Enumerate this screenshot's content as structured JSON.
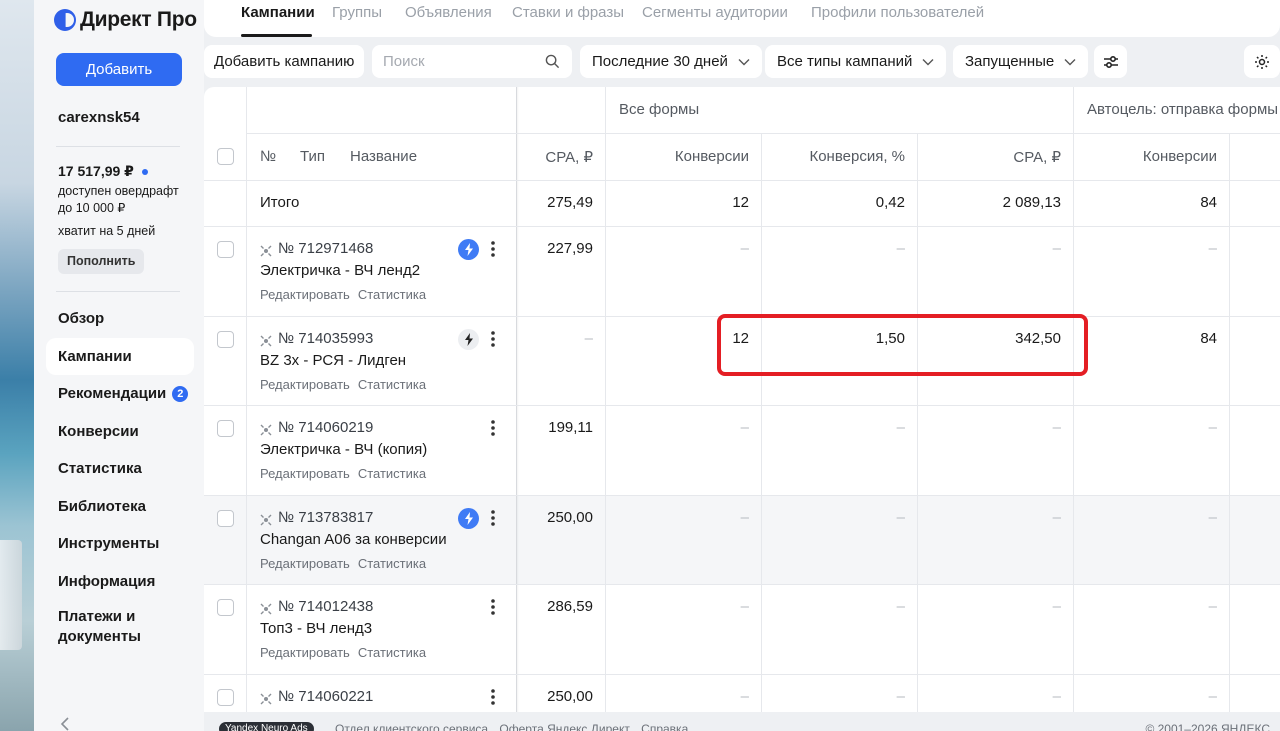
{
  "sidebar": {
    "logo": "Директ Про",
    "add_button": "Добавить",
    "login": "carexnsk54",
    "balance": "17 517,99 ₽",
    "overdraft": "доступен овердрафт до 10 000 ₽",
    "enough": "хватит на 5 дней",
    "topup": "Пополнить",
    "nav": [
      {
        "label": "Обзор"
      },
      {
        "label": "Кампании"
      },
      {
        "label": "Рекомендации",
        "badge": "2"
      },
      {
        "label": "Конверсии"
      },
      {
        "label": "Статистика"
      },
      {
        "label": "Библиотека"
      },
      {
        "label": "Инструменты"
      },
      {
        "label": "Информация"
      },
      {
        "label": "Платежи и документы"
      }
    ]
  },
  "tabs": [
    "Кампании",
    "Группы",
    "Объявления",
    "Ставки и фразы",
    "Сегменты аудитории",
    "Профили пользователей"
  ],
  "toolbar": {
    "add_campaign": "Добавить кампанию",
    "search_placeholder": "Поиск",
    "period": "Последние 30 дней",
    "types": "Все типы кампаний",
    "status": "Запущенные"
  },
  "table": {
    "group_headers": {
      "all_forms": "Все формы",
      "autogoal": "Автоцель: отправка формы"
    },
    "headers": {
      "num": "№",
      "type": "Тип",
      "name": "Название",
      "cpa": "CPA, ₽",
      "conv": "Конверсии",
      "conv_pct": "Конверсия, %",
      "cpa2": "CPA, ₽",
      "conv2": "Конверсии"
    },
    "total": {
      "label": "Итого",
      "cpa": "275,49",
      "conv": "12",
      "conv_pct": "0,42",
      "cpa2": "2 089,13",
      "conv2": "84"
    },
    "edit_label": "Редактировать",
    "stats_label": "Статистика",
    "rows": [
      {
        "num": "№ 712971468",
        "name": "Электричка - ВЧ ленд2",
        "cpa": "227,99",
        "conv": "–",
        "conv_pct": "–",
        "cpa2": "–",
        "conv2": "–"
      },
      {
        "num": "№ 714035993",
        "name": "BZ 3x - РСЯ - Лидген",
        "cpa": "–",
        "conv": "12",
        "conv_pct": "1,50",
        "cpa2": "342,50",
        "conv2": "84"
      },
      {
        "num": "№ 714060219",
        "name": "Электричка - ВЧ (копия)",
        "cpa": "199,11",
        "conv": "–",
        "conv_pct": "–",
        "cpa2": "–",
        "conv2": "–"
      },
      {
        "num": "№ 713783817",
        "name": "Changan A06 за конверсии",
        "cpa": "250,00",
        "conv": "–",
        "conv_pct": "–",
        "cpa2": "–",
        "conv2": "–"
      },
      {
        "num": "№ 714012438",
        "name": "Топ3 - ВЧ ленд3",
        "cpa": "286,59",
        "conv": "–",
        "conv_pct": "–",
        "cpa2": "–",
        "conv2": "–"
      },
      {
        "num": "№ 714060221",
        "name": "",
        "cpa": "250,00",
        "conv": "–",
        "conv_pct": "–",
        "cpa2": "–",
        "conv2": "–"
      }
    ]
  },
  "footer": {
    "logo": "Yandex Neuro Ads",
    "links": [
      "Отдел клиентского сервиса",
      "Оферта Яндекс Директ",
      "Справка"
    ],
    "copyright": "© 2001–2026 ЯНДЕКС"
  },
  "colors": {
    "accent": "#2f6bf2",
    "highlight": "#e41e24"
  }
}
